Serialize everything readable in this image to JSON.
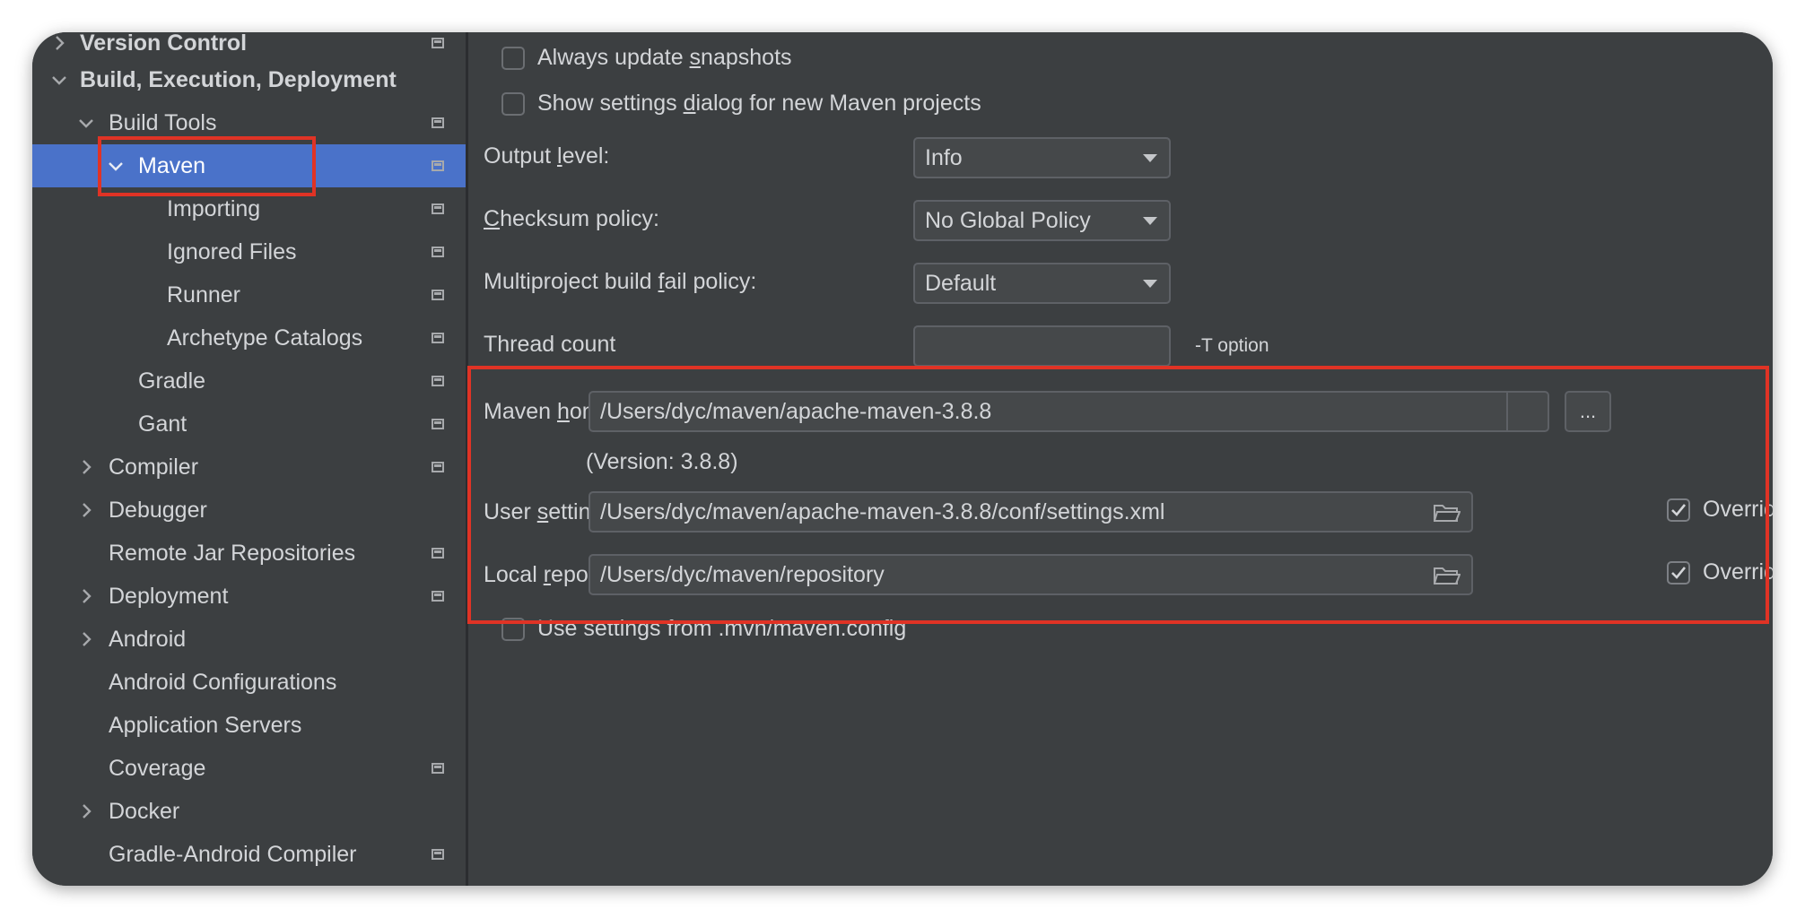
{
  "sidebar": {
    "items": [
      {
        "label": "Version Control",
        "expanded": false
      },
      {
        "label": "Build, Execution, Deployment",
        "expanded": true
      },
      {
        "label": "Build Tools",
        "expanded": true
      },
      {
        "label": "Maven",
        "expanded": true,
        "selected": true
      },
      {
        "label": "Importing"
      },
      {
        "label": "Ignored Files"
      },
      {
        "label": "Runner"
      },
      {
        "label": "Archetype Catalogs"
      },
      {
        "label": "Gradle"
      },
      {
        "label": "Gant"
      },
      {
        "label": "Compiler",
        "expanded": false
      },
      {
        "label": "Debugger",
        "expanded": false
      },
      {
        "label": "Remote Jar Repositories"
      },
      {
        "label": "Deployment",
        "expanded": false
      },
      {
        "label": "Android",
        "expanded": false
      },
      {
        "label": "Android Configurations"
      },
      {
        "label": "Application Servers"
      },
      {
        "label": "Coverage"
      },
      {
        "label": "Docker",
        "expanded": false
      },
      {
        "label": "Gradle-Android Compiler"
      }
    ]
  },
  "main": {
    "always_update_snapshots": {
      "pre": "Always update ",
      "mnemonic": "s",
      "post": "napshots",
      "checked": false
    },
    "show_settings_dialog": {
      "pre": "Show settings ",
      "mnemonic": "d",
      "post": "ialog for new Maven projects",
      "checked": false
    },
    "output_level": {
      "pre": "Output ",
      "mnemonic": "l",
      "post": "evel:",
      "value": "Info"
    },
    "checksum_policy": {
      "pre": "",
      "mnemonic": "C",
      "post": "hecksum policy:",
      "value": "No Global Policy"
    },
    "multiproject_fail_policy": {
      "pre": "Multiproject build ",
      "mnemonic": "f",
      "post": "ail policy:",
      "value": "Default"
    },
    "thread_count": {
      "label": "Thread count",
      "value": "",
      "hint": "-T option"
    },
    "maven_home": {
      "pre": "Maven ",
      "mnemonic": "h",
      "post": "ome path:",
      "value": "/Users/dyc/maven/apache-maven-3.8.8",
      "browse_label": "...",
      "version": "(Version: 3.8.8)"
    },
    "user_settings": {
      "pre": "User ",
      "mnemonic": "s",
      "post": "ettings file:",
      "value": "/Users/dyc/maven/apache-maven-3.8.8/conf/settings.xml",
      "override_label": "Override",
      "override_checked": true
    },
    "local_repo": {
      "pre": "Local ",
      "mnemonic": "r",
      "post": "epository:",
      "value": "/Users/dyc/maven/repository",
      "override_label": "Override",
      "override_checked": true
    },
    "use_mvn_config": {
      "label": "Use settings from .mvn/maven.config",
      "checked": false
    }
  },
  "colors": {
    "background": "#3c3f41",
    "selection": "#4a72c9",
    "highlight": "#e03325",
    "text": "#d3d5d8"
  }
}
